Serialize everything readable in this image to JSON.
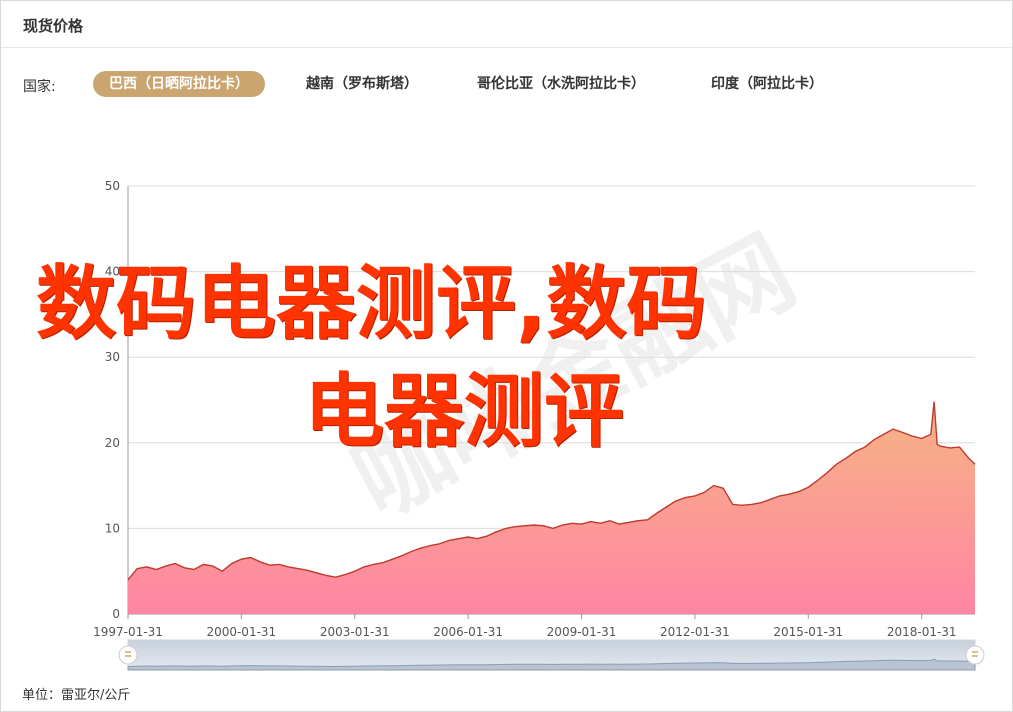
{
  "header": {
    "title": "现货价格"
  },
  "country_selector": {
    "label": "国家:",
    "tabs": [
      {
        "label": "巴西（日晒阿拉比卡）",
        "active": true
      },
      {
        "label": "越南（罗布斯塔）",
        "active": false
      },
      {
        "label": "哥伦比亚（水洗阿拉比卡）",
        "active": false
      },
      {
        "label": "印度（阿拉比卡）",
        "active": false
      }
    ]
  },
  "footer": {
    "unit": "单位：雷亚尔/公斤"
  },
  "overlay": {
    "line1": "数码电器测评,数码",
    "line2": "电器测评",
    "watermark": "咖啡金融网"
  },
  "colors": {
    "accent": "#cba56f",
    "line": "#c0392b",
    "fill_top": "#f6b07e",
    "fill_bottom": "#ff7f9e",
    "overlay_text": "#ff3300"
  },
  "chart_data": {
    "type": "area",
    "title": "",
    "xlabel": "",
    "ylabel": "",
    "ylim": [
      0,
      50
    ],
    "yticks": [
      0,
      10,
      20,
      30,
      40,
      50
    ],
    "xlim": [
      "1997-01-31",
      "2019-06-30"
    ],
    "xticks": [
      "1997-01-31",
      "2000-01-31",
      "2003-01-31",
      "2006-01-31",
      "2009-01-31",
      "2012-01-31",
      "2015-01-31",
      "2018-01-31"
    ],
    "grid": true,
    "x": [
      "1997-01-31",
      "1997-04-30",
      "1997-07-31",
      "1997-10-31",
      "1998-01-31",
      "1998-04-30",
      "1998-07-31",
      "1998-10-31",
      "1999-01-31",
      "1999-04-30",
      "1999-07-31",
      "1999-10-31",
      "2000-01-31",
      "2000-04-30",
      "2000-07-31",
      "2000-10-31",
      "2001-01-31",
      "2001-04-30",
      "2001-07-31",
      "2001-10-31",
      "2002-01-31",
      "2002-04-30",
      "2002-07-31",
      "2002-10-31",
      "2003-01-31",
      "2003-04-30",
      "2003-07-31",
      "2003-10-31",
      "2004-01-31",
      "2004-04-30",
      "2004-07-31",
      "2004-10-31",
      "2005-01-31",
      "2005-04-30",
      "2005-07-31",
      "2005-10-31",
      "2006-01-31",
      "2006-04-30",
      "2006-07-31",
      "2006-10-31",
      "2007-01-31",
      "2007-04-30",
      "2007-07-31",
      "2007-10-31",
      "2008-01-31",
      "2008-04-30",
      "2008-07-31",
      "2008-10-31",
      "2009-01-31",
      "2009-04-30",
      "2009-07-31",
      "2009-10-31",
      "2010-01-31",
      "2010-04-30",
      "2010-07-31",
      "2010-10-31",
      "2011-01-31",
      "2011-04-30",
      "2011-07-31",
      "2011-10-31",
      "2012-01-31",
      "2012-04-30",
      "2012-07-31",
      "2012-10-31",
      "2013-01-31",
      "2013-04-30",
      "2013-07-31",
      "2013-10-31",
      "2014-01-31",
      "2014-04-30",
      "2014-07-31",
      "2014-10-31",
      "2015-01-31",
      "2015-04-30",
      "2015-07-31",
      "2015-10-31",
      "2016-01-31",
      "2016-04-30",
      "2016-07-31",
      "2016-10-31",
      "2017-01-31",
      "2017-04-30",
      "2017-07-31",
      "2017-10-31",
      "2018-01-31",
      "2018-04-30",
      "2018-05-31",
      "2018-06-30",
      "2018-07-31",
      "2018-10-31",
      "2019-01-31",
      "2019-04-30",
      "2019-06-30"
    ],
    "series": [
      {
        "values": [
          4.0,
          5.3,
          5.5,
          5.2,
          5.6,
          5.9,
          5.4,
          5.2,
          5.8,
          5.6,
          5.0,
          5.9,
          6.4,
          6.6,
          6.1,
          5.7,
          5.8,
          5.5,
          5.3,
          5.1,
          4.8,
          4.5,
          4.3,
          4.6,
          5.0,
          5.5,
          5.8,
          6.0,
          6.4,
          6.8,
          7.3,
          7.7,
          8.0,
          8.2,
          8.6,
          8.8,
          9.0,
          8.8,
          9.1,
          9.6,
          10.0,
          10.2,
          10.3,
          10.4,
          10.3,
          10.0,
          10.4,
          10.6,
          10.5,
          10.8,
          10.6,
          10.9,
          10.5,
          10.7,
          10.9,
          11.0,
          11.8,
          12.5,
          13.2,
          13.6,
          13.8,
          14.2,
          15.0,
          14.7,
          12.8,
          12.7,
          12.8,
          13.0,
          13.4,
          13.8,
          14.0,
          14.3,
          14.8,
          15.6,
          16.5,
          17.5,
          18.2,
          19.0,
          19.5,
          20.4,
          21.0,
          21.6,
          21.2,
          20.8,
          20.5,
          21.0,
          24.8,
          19.8,
          19.6,
          19.4,
          19.5,
          18.2,
          17.5
        ]
      }
    ]
  }
}
